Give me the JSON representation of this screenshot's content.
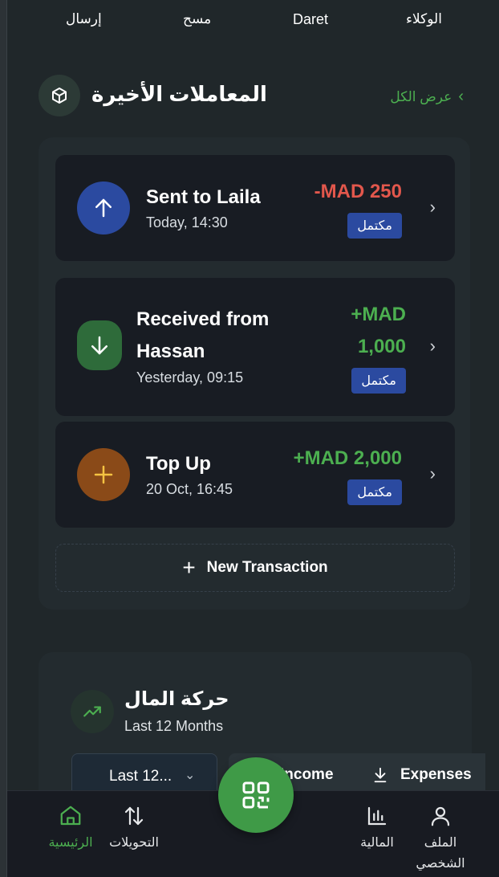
{
  "quick_actions": [
    {
      "label": "إرسال"
    },
    {
      "label": "مسح"
    },
    {
      "label": "Daret"
    },
    {
      "label": "الوكلاء"
    }
  ],
  "recent": {
    "title": "المعاملات الأخيرة",
    "view_all": "عرض الكل",
    "transactions": [
      {
        "title": "Sent to Laila",
        "time": "Today, 14:30",
        "amount": "-MAD 250",
        "status": "مكتمل",
        "direction": "sent",
        "icon": "arrow-up-icon",
        "color": "#2b4aa0",
        "amount_color": "#e2574c"
      },
      {
        "title": "Received from Hassan",
        "time": "Yesterday, 09:15",
        "amount": "+MAD 1,000",
        "status": "مكتمل",
        "direction": "received",
        "icon": "arrow-down-icon",
        "color": "#2e6b3a",
        "amount_color": "#4caf50"
      },
      {
        "title": "Top Up",
        "time": "20 Oct, 16:45",
        "amount": "+MAD 2,000",
        "status": "مكتمل",
        "direction": "topup",
        "icon": "plus-icon",
        "color": "#8a4a18",
        "amount_color": "#4caf50"
      }
    ],
    "new_transaction": "New Transaction"
  },
  "money_movement": {
    "title": "حركة المال",
    "subtitle": "Last 12 Months",
    "period_select": "Last 12...",
    "toggles": [
      {
        "label": "Income",
        "icon": "arrow-up-icon"
      },
      {
        "label": "Expenses",
        "icon": "arrow-down-icon"
      }
    ]
  },
  "bottom_nav": {
    "home": "الرئيسية",
    "transfers": "التحويلات",
    "finance": "المالية",
    "profile": "الملف الشخصي",
    "scan": "qr-code-icon"
  },
  "colors": {
    "accent": "#4caf50",
    "badge": "#2b4aa0",
    "card": "#181c23",
    "background": "#20272a"
  }
}
